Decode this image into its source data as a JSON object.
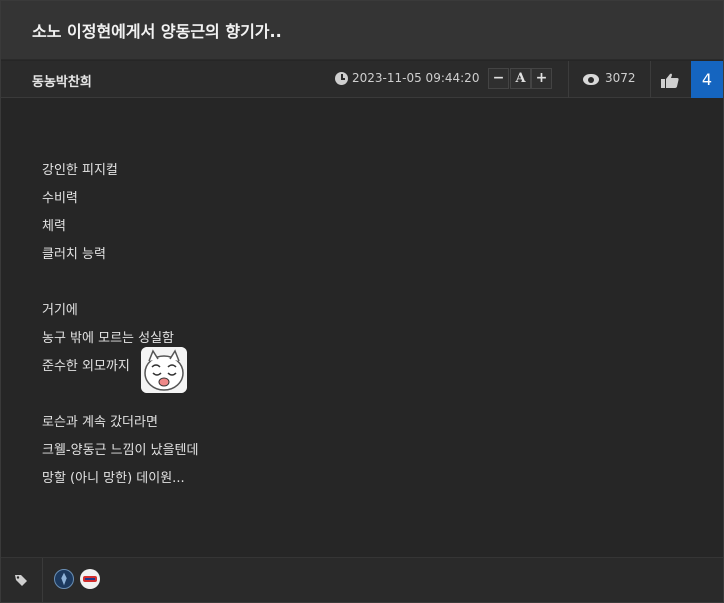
{
  "post": {
    "title": "소노 이정현에게서 양동근의 향기가..",
    "author": "동농박찬희",
    "datetime": "2023-11-05 09:44:20",
    "views": "3072",
    "likes": "4",
    "font_controls": {
      "decrease": "−",
      "reset": "A",
      "increase": "+"
    }
  },
  "body_lines": [
    "강인한 피지컬",
    "수비력",
    "체력",
    "클러치 능력",
    "",
    "거기에",
    "농구 밖에 모르는 성실함",
    "준수한 외모까지",
    "",
    "로슨과 계속 갔더라면",
    "크웰-양동근 느낌이 났을텐데",
    "망할 (아니 망한) 데이원..."
  ],
  "colors": {
    "accent": "#1565c0",
    "background": "#262626",
    "title_bar": "#343434"
  },
  "icons": [
    "clock-icon",
    "eye-icon",
    "thumbs-up-icon",
    "tag-icon",
    "emoticon"
  ]
}
